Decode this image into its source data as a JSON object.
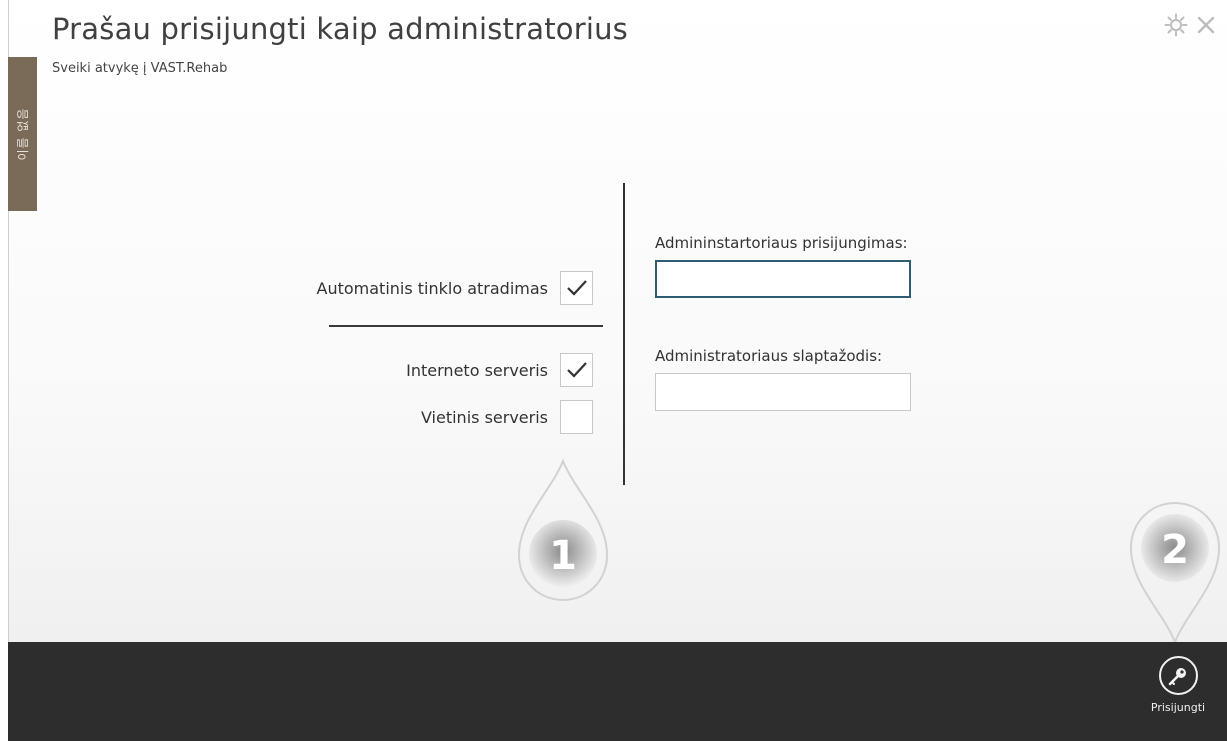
{
  "header": {
    "title": "Prašau prisijungti kaip administratorius",
    "subtitle": "Sveiki atvykę į VAST.Rehab"
  },
  "side_tab": {
    "label": "이름 없음"
  },
  "top_icons": [
    "gear-icon",
    "close-icon"
  ],
  "left_panel": {
    "auto_discovery": {
      "label": "Automatinis tinklo atradimas",
      "checked": true
    },
    "internet_server": {
      "label": "Interneto serveris",
      "checked": true
    },
    "local_server": {
      "label": "Vietinis serveris",
      "checked": false
    }
  },
  "right_panel": {
    "login_label": "Admininstartoriaus prisijungimas:",
    "login_value": "",
    "password_label": "Administratoriaus slaptažodis:",
    "password_value": ""
  },
  "markers": [
    "1",
    "2"
  ],
  "bottom_bar": {
    "login_button_label": "Prisijungti",
    "login_icon": "key-icon"
  },
  "colors": {
    "bottom_bar": "#2d2d2d",
    "side_tab": "#7a6b58",
    "focused_input_border": "#2c5d72"
  }
}
